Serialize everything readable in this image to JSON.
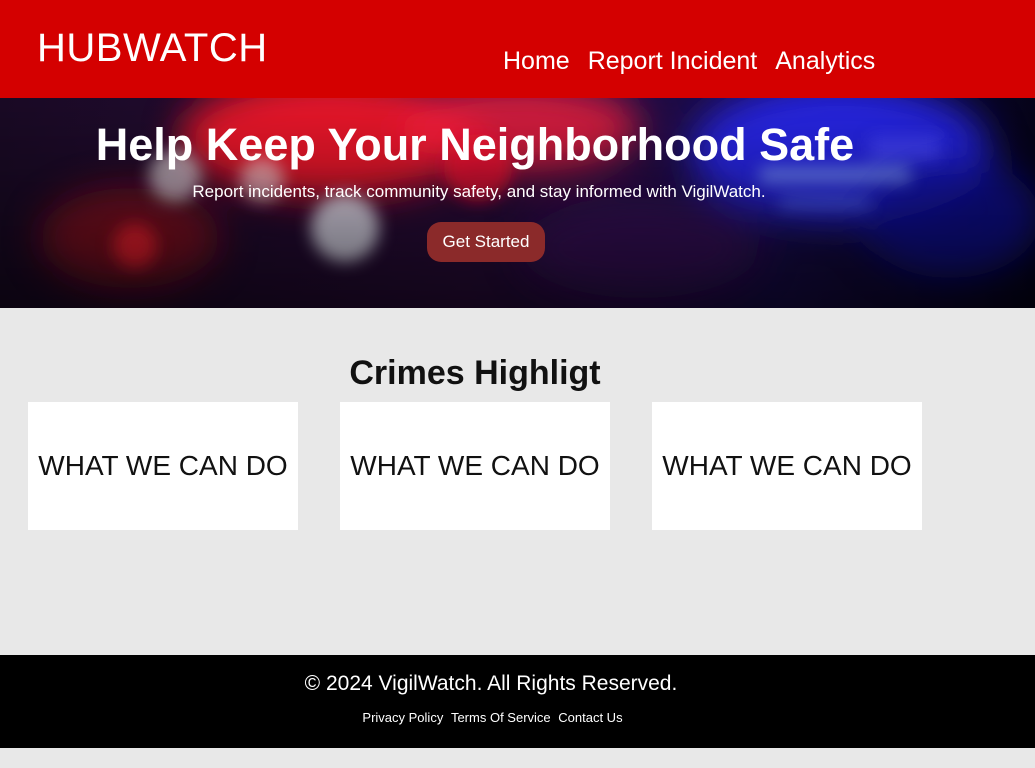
{
  "header": {
    "brand": "HUBWATCH",
    "nav": [
      "Home",
      "Report Incident",
      "Analytics"
    ]
  },
  "hero": {
    "title": "Help Keep Your Neighborhood Safe",
    "subtitle": "Report incidents, track community safety, and stay informed with VigilWatch.",
    "cta_label": "Get Started"
  },
  "highlights": {
    "title": "Crimes Highligt",
    "cards": [
      "WHAT WE CAN DO",
      "WHAT WE CAN DO",
      "WHAT WE CAN DO"
    ]
  },
  "footer": {
    "copyright": "© 2024 VigilWatch. All Rights Reserved.",
    "links": [
      "Privacy Policy",
      "Terms Of Service",
      "Contact Us"
    ]
  },
  "colors": {
    "header_bg": "#d40000",
    "cta_bg": "#8b2a2a",
    "footer_bg": "#000000",
    "page_bg": "#e8e8e8"
  }
}
